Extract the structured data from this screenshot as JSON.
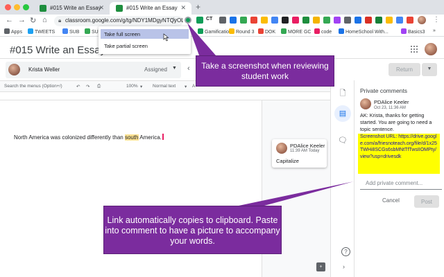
{
  "browser": {
    "tabs": [
      {
        "title": "#015 Write an Essay",
        "active": false
      },
      {
        "title": "#015 Write an Essay",
        "active": true
      }
    ],
    "new_tab": "+",
    "url": "classroom.google.com/g/tg/NDY1MDgyNTQyODD...",
    "bookmarks": [
      {
        "label": "Apps",
        "color": "#5f6368"
      },
      {
        "label": "TWEETS",
        "color": "#1da1f2"
      },
      {
        "label": "SUB",
        "color": "#4285f4"
      },
      {
        "label": "SUB",
        "color": "#34a853"
      },
      {
        "label": "Gamification",
        "color": "#0f9d58"
      },
      {
        "label": "Round 3",
        "color": "#fbbc04"
      },
      {
        "label": "DOK",
        "color": "#ea4335"
      },
      {
        "label": "MORE GC",
        "color": "#34a853"
      },
      {
        "label": "code",
        "color": "#e91e63"
      },
      {
        "label": "HomeSchool With...",
        "color": "#1a73e8"
      },
      {
        "label": "Basics3",
        "color": "#a142f4"
      }
    ]
  },
  "screenshot_menu": {
    "full_label": "Take full screen",
    "partial_label": "Take partial screen"
  },
  "classroom": {
    "assignment_title": "#015 Write an Essay",
    "student_name": "Krista Weller",
    "status": "Assigned",
    "return_label": "Return"
  },
  "docs_toolbar": {
    "search_menus": "Search the menus (Option+/)",
    "zoom": "100%",
    "style": "Normal text"
  },
  "document": {
    "text_before": "North America was colonized differently than ",
    "text_highlight": "south",
    "text_after": " America."
  },
  "doc_comment": {
    "author": "PDAlice Keeler",
    "time": "11:39 AM Today",
    "body": "Capitalize"
  },
  "private_comments": {
    "title": "Private comments",
    "author": "PDAlice Keeler",
    "time": "Oct 23, 11:36 AM",
    "message": "AK: Krista, thanks for getting started. You are going to need a topic sentence.",
    "url_text": "Screenshot URL: https://drive.google.com/a/friesnoteach.org/file/d/1x25TWHi8SCGs6sbMNtTfTwsIIOMPty/view?usp=drivesdk",
    "input_placeholder": "Add private comment...",
    "cancel_label": "Cancel",
    "post_label": "Post"
  },
  "callouts": {
    "top": "Take a screenshot when reviewing student work",
    "bottom": "Link automatically copies to clipboard. Paste into comment to have a picture to accompany your words."
  },
  "colors": {
    "callout_purple": "#7b2c9e",
    "highlight_yellow": "#ffff00",
    "menu_selected": "#b9c3e8"
  }
}
